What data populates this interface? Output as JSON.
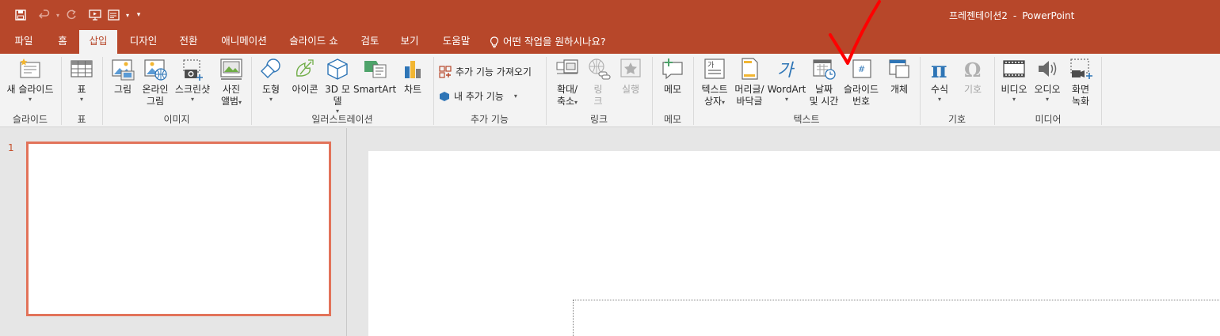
{
  "window": {
    "doc_title": "프레젠테이션2",
    "separator": "-",
    "app_name": "PowerPoint"
  },
  "qat": {
    "save_icon": "save-icon",
    "undo_icon": "undo-icon",
    "redo_icon": "redo-icon",
    "start_from_beginning_icon": "slideshow-from-start-icon",
    "layout_icon": "layout-icon",
    "customize_icon": "customize-qat-icon"
  },
  "tabs": [
    {
      "label": "파일"
    },
    {
      "label": "홈"
    },
    {
      "label": "삽입"
    },
    {
      "label": "디자인"
    },
    {
      "label": "전환"
    },
    {
      "label": "애니메이션"
    },
    {
      "label": "슬라이드 쇼"
    },
    {
      "label": "검토"
    },
    {
      "label": "보기"
    },
    {
      "label": "도움말"
    }
  ],
  "tell_me": "어떤 작업을 원하시나요?",
  "ribbon": {
    "slides": {
      "label": "슬라이드",
      "new_slide": "새 슬라이드"
    },
    "table": {
      "label": "표",
      "table": "표"
    },
    "images": {
      "label": "이미지",
      "pictures": "그림",
      "online_pictures_1": "온라인",
      "online_pictures_2": "그림",
      "screenshot": "스크린샷",
      "photo_album_1": "사진",
      "photo_album_2": "앨범"
    },
    "illustrations": {
      "label": "일러스트레이션",
      "shapes": "도형",
      "icons": "아이콘",
      "models_1": "3D 모",
      "models_2": "델",
      "smartart": "SmartArt",
      "chart": "차트"
    },
    "addins": {
      "label": "추가 기능",
      "get_addins": "추가 기능 가져오기",
      "my_addins": "내 추가 기능"
    },
    "links": {
      "label": "링크",
      "zoom_1": "확대/",
      "zoom_2": "축소",
      "link_1": "링",
      "link_2": "크",
      "action": "실행"
    },
    "comments": {
      "label": "메모",
      "comment": "메모"
    },
    "text": {
      "label": "텍스트",
      "textbox_1": "텍스트",
      "textbox_2": "상자",
      "header_footer_1": "머리글/",
      "header_footer_2": "바닥글",
      "wordart": "WordArt",
      "datetime_1": "날짜",
      "datetime_2": "및 시간",
      "slide_number_1": "슬라이드",
      "slide_number_2": "번호",
      "object": "개체"
    },
    "symbols": {
      "label": "기호",
      "equation": "수식",
      "symbol": "기호"
    },
    "media": {
      "label": "미디어",
      "video": "비디오",
      "audio": "오디오",
      "screen_recording_1": "화면",
      "screen_recording_2": "녹화"
    }
  },
  "thumbnails": {
    "slide_number": "1"
  },
  "colors": {
    "accent": "#b7472a",
    "annotation": "#ff0000",
    "thumb_border": "#e2735a"
  }
}
